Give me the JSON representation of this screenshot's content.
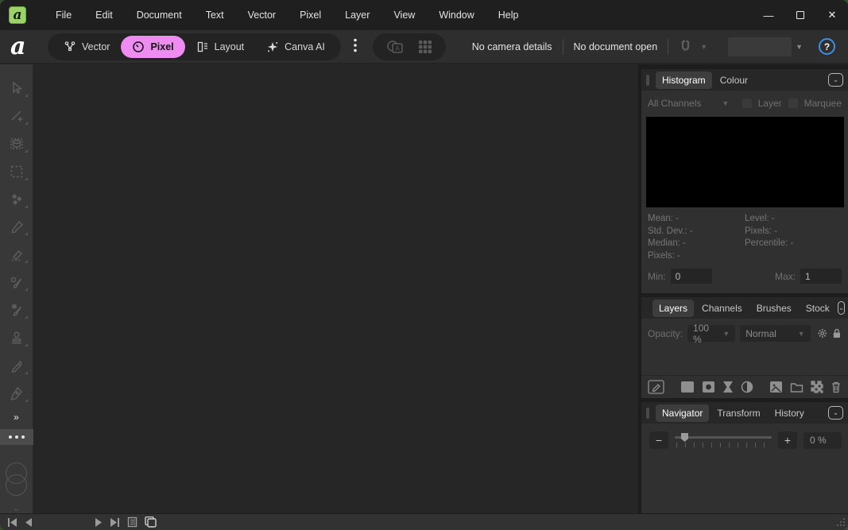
{
  "colors": {
    "titlebar_bg": "#1f1f1f",
    "toolbar_bg": "#2e2e2e",
    "canvas_bg": "#262626",
    "panel_bg": "#303030",
    "left_toolbar_bg": "#383838",
    "persona_active_pink": "#ef8cf1",
    "logo_green": "#9bd36a",
    "help_ring_blue": "#3f8fe0",
    "desktop_green": "#33502e"
  },
  "titlebar": {
    "app_logo_letter": "a",
    "menu_items": [
      "File",
      "Edit",
      "Document",
      "Text",
      "Vector",
      "Pixel",
      "Layer",
      "View",
      "Window",
      "Help"
    ],
    "controls": {
      "minimize": "—",
      "maximize": "",
      "close": "✕"
    }
  },
  "toolbar": {
    "brand_letter": "a",
    "personas": [
      {
        "label": "Vector",
        "active": false
      },
      {
        "label": "Pixel",
        "active": true
      },
      {
        "label": "Layout",
        "active": false
      },
      {
        "label": "Canva AI",
        "active": false
      }
    ],
    "status_camera": "No camera details",
    "status_document": "No document open",
    "help_label": "?"
  },
  "left_toolbox": {
    "tools": [
      "move-tool",
      "measure-tool",
      "mesh-warp-tool",
      "marquee-select-tool",
      "flood-select-tool",
      "paint-brush-tool",
      "erase-brush-tool",
      "selection-brush-tool",
      "colour-replacement-brush-tool",
      "clone-stamp-tool",
      "smudge-tool",
      "pen-tool"
    ],
    "expand_label": "»",
    "colour_wells": "stroke-fill-circles"
  },
  "panels": {
    "histogram": {
      "tabs": [
        "Histogram",
        "Colour"
      ],
      "active_tab": "Histogram",
      "channels_dropdown": "All Channels",
      "checkbox_layer": "Layer",
      "checkbox_marquee": "Marquee",
      "stats": {
        "mean_label": "Mean:",
        "mean_value": "-",
        "stddev_label": "Std. Dev.:",
        "stddev_value": "-",
        "median_label": "Median:",
        "median_value": "-",
        "pixels_label": "Pixels:",
        "pixels_value": "-",
        "level_label": "Level:",
        "level_value": "-",
        "pixels2_label": "Pixels:",
        "pixels2_value": "-",
        "percentile_label": "Percentile:",
        "percentile_value": "-"
      },
      "min_label": "Min:",
      "min_value": "0",
      "max_label": "Max:",
      "max_value": "1"
    },
    "layers": {
      "tabs": [
        "Layers",
        "Channels",
        "Brushes",
        "Stock"
      ],
      "active_tab": "Layers",
      "opacity_label": "Opacity:",
      "opacity_value": "100 %",
      "blend_mode": "Normal"
    },
    "navigator": {
      "tabs": [
        "Navigator",
        "Transform",
        "History"
      ],
      "active_tab": "Navigator",
      "zoom_value": "0 %"
    }
  }
}
